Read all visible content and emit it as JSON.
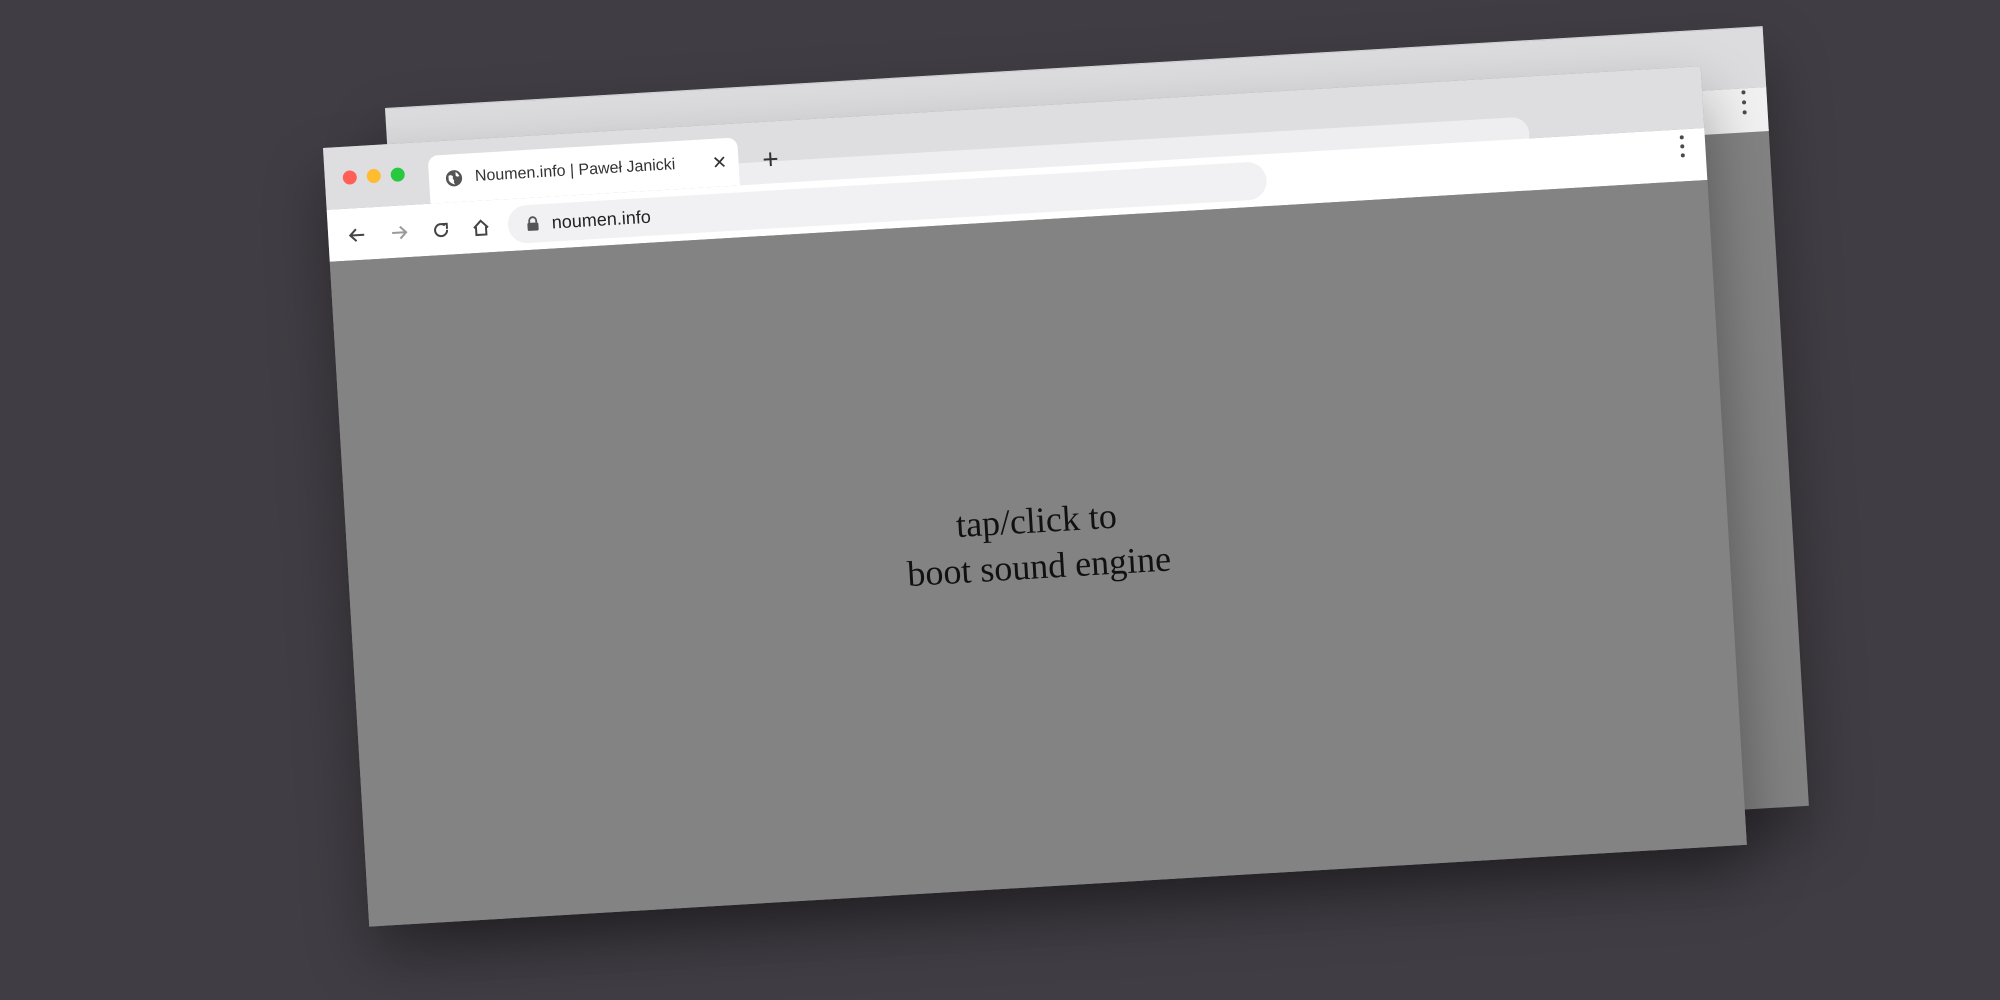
{
  "browser": {
    "tab": {
      "title": "Noumen.info | Paweł Janicki",
      "close_glyph": "✕"
    },
    "new_tab_glyph": "+",
    "address_bar": {
      "url": "noumen.info"
    },
    "icons": {
      "favicon": "globe-icon",
      "back": "arrow-left-icon",
      "forward": "arrow-right-icon",
      "reload": "reload-icon",
      "home": "home-icon",
      "lock": "lock-icon",
      "menu": "kebab-menu-icon"
    },
    "traffic_lights": {
      "close": "#ff5f57",
      "minimize": "#febc2e",
      "maximize": "#28c840"
    }
  },
  "page": {
    "message_line1": "tap/click to",
    "message_line2": "boot sound engine",
    "background_color": "#838383"
  },
  "scene": {
    "background_color": "#413d44"
  }
}
